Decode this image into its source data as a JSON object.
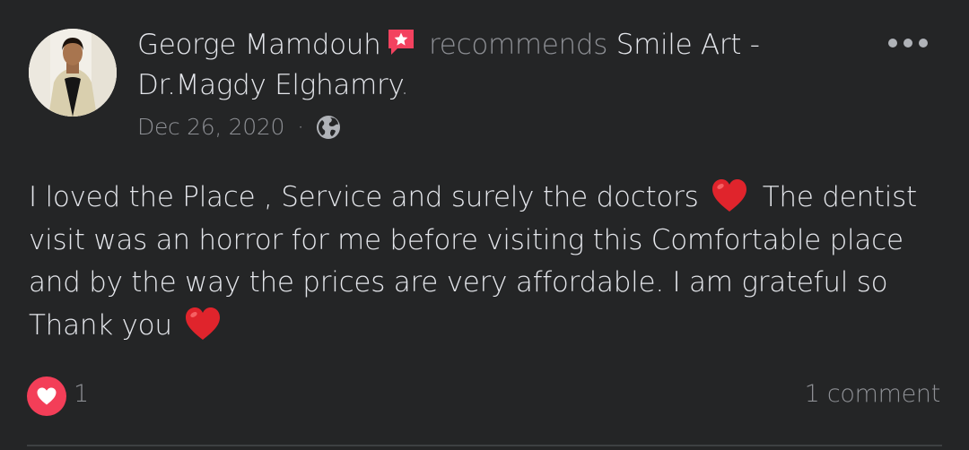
{
  "post": {
    "author": "George Mamdouh",
    "action": "recommends",
    "page_name": "Smile Art - Dr.Magdy Elghamry",
    "page_suffix": ".",
    "date": "Dec 26, 2020",
    "separator": "·",
    "privacy_icon": "globe-icon",
    "recommend_icon": "star-speech-bubble-icon",
    "more_icon": "more-horizontal-icon",
    "body": {
      "part1": "I loved the Place , Service and surely the doctors",
      "part2": " The dentist visit was an horror for me before visiting this Comfortable place and by the way the prices are very affordable. I am grateful so Thank you",
      "emoji": "red-heart-emoji"
    },
    "reactions": {
      "icon": "love-reaction-icon",
      "count": "1"
    },
    "comments_label": "1 comment"
  },
  "colors": {
    "background": "#242526",
    "primary_text": "#e4e6eb",
    "secondary_text": "#8e9095",
    "love": "#f33e58",
    "recommend_badge": "#f3425f",
    "divider": "#3e4042"
  }
}
